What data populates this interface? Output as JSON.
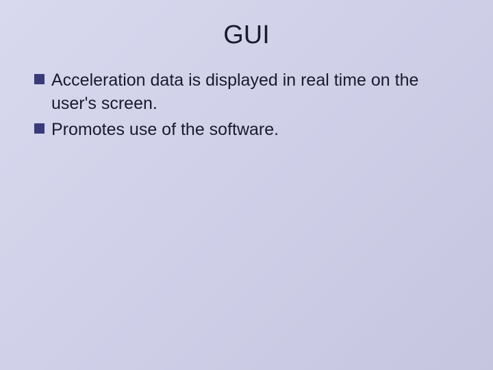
{
  "slide": {
    "title": "GUI",
    "bullets": [
      {
        "text": "Acceleration data is displayed in real time on the user's screen."
      },
      {
        "text": "Promotes use of the software."
      }
    ]
  }
}
